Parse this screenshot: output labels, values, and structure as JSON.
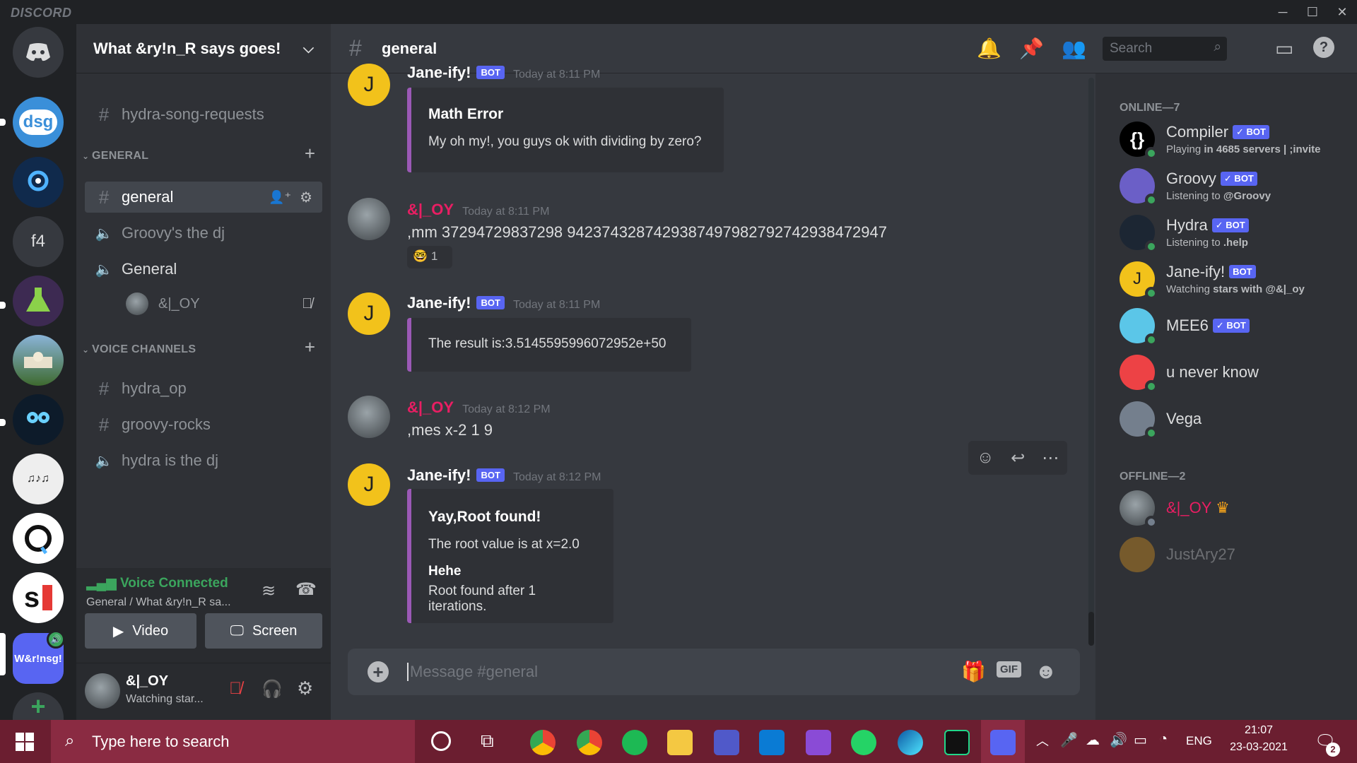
{
  "app": {
    "brand": "DISCORD"
  },
  "server": {
    "name": "What &ry!n_R says goes!"
  },
  "channels": {
    "top": "hydra-song-requests",
    "general_category": "GENERAL",
    "general": "general",
    "groovy_dj": "Groovy's the dj",
    "general_voice": "General",
    "voice_user": "&|_OY",
    "voice_category": "VOICE CHANNELS",
    "hydra_op": "hydra_op",
    "groovy_rocks": "groovy-rocks",
    "hydra_dj": "hydra is the dj"
  },
  "voice": {
    "status": "Voice Connected",
    "location": "General / What &ry!n_R sa...",
    "video": "Video",
    "screen": "Screen"
  },
  "user": {
    "name": "&|_OY",
    "status": "Watching star..."
  },
  "header": {
    "channel": "general",
    "search_placeholder": "Search"
  },
  "messages": [
    {
      "author": "Jane-ify!",
      "bot": "BOT",
      "time": "Today at 8:11 PM",
      "embed_title": "Math Error",
      "embed_text": "My oh my!, you guys ok with dividing by zero?"
    },
    {
      "author": "&|_OY",
      "time": "Today at 8:11 PM",
      "text": ",mm 37294729837298 9423743287429387497982792742938472947",
      "reaction_count": "1"
    },
    {
      "author": "Jane-ify!",
      "bot": "BOT",
      "time": "Today at 8:11 PM",
      "embed_text": "The result is:3.5145595996072952e+50"
    },
    {
      "author": "&|_OY",
      "time": "Today at 8:12 PM",
      "text": ",mes x-2 1 9"
    },
    {
      "author": "Jane-ify!",
      "bot": "BOT",
      "time": "Today at 8:12 PM",
      "embed_title": "Yay,Root found!",
      "embed_text": "The root value is at x=2.0",
      "field_name": "Hehe",
      "field_value": "Root found after 1 iterations."
    }
  ],
  "composer": {
    "placeholder": "Message #general",
    "gif": "GIF"
  },
  "members": {
    "online_label": "ONLINE—7",
    "offline_label": "OFFLINE—2",
    "online": [
      {
        "name": "Compiler",
        "tag": "✓ BOT",
        "activity_prefix": "Playing ",
        "activity": "in 4685 servers | ;invite"
      },
      {
        "name": "Groovy",
        "tag": "✓ BOT",
        "activity_prefix": "Listening to ",
        "activity": "@Groovy"
      },
      {
        "name": "Hydra",
        "tag": "✓ BOT",
        "activity_prefix": "Listening to ",
        "activity": ".help"
      },
      {
        "name": "Jane-ify!",
        "tag": "BOT",
        "activity_prefix": "Watching ",
        "activity": "stars with @&|_oy"
      },
      {
        "name": "MEE6",
        "tag": "✓ BOT"
      },
      {
        "name": "u never know"
      },
      {
        "name": "Vega"
      }
    ],
    "offline": [
      {
        "name": "&|_OY"
      },
      {
        "name": "JustAry27"
      }
    ]
  },
  "taskbar": {
    "search": "Type here to search",
    "lang": "ENG",
    "time": "21:07",
    "date": "23-03-2021",
    "notif_count": "2"
  },
  "servers": {
    "f4": "f4",
    "dsg": "dsg",
    "wr": "W&r!nsg!"
  },
  "colors": {
    "accent": "#5865f2",
    "online": "#3ba55d",
    "voice_green": "#3ba55d",
    "embed_bar": "#9b59b6",
    "oy_name": "#e91e63"
  }
}
